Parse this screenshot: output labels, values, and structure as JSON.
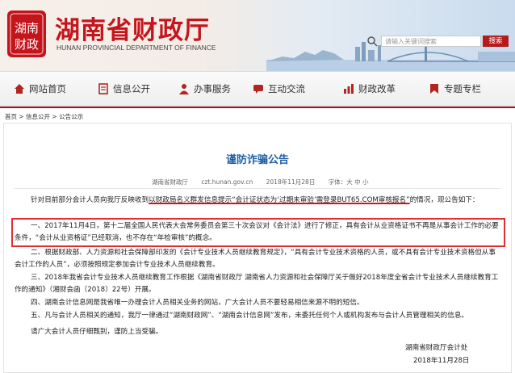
{
  "header": {
    "logo_text": "湖南财政",
    "title": "湖南省财政厅",
    "subtitle": "HUNAN PROVINCIAL DEPARTMENT OF FINANCE",
    "search_placeholder": "请输入关键词搜索",
    "search_button": "搜索"
  },
  "nav": {
    "items": [
      {
        "label": "网站首页",
        "icon": "home-icon"
      },
      {
        "label": "信息公开",
        "icon": "document-icon"
      },
      {
        "label": "办事服务",
        "icon": "service-icon"
      },
      {
        "label": "互动交流",
        "icon": "chat-icon"
      },
      {
        "label": "财政改革",
        "icon": "reform-icon"
      },
      {
        "label": "专题专栏",
        "icon": "topic-icon"
      }
    ]
  },
  "breadcrumb": "首页 > 信息公开 > 公告公示",
  "article": {
    "title": "谨防诈骗公告",
    "source": "湖南省财政厅",
    "url": "czt.hunan.gov.cn",
    "date": "2018年11月28日",
    "font_size": "字体：大 中 小",
    "intro_a": "针对目前部分会计人员向我厅反映收到",
    "intro_b": "以财政局名义群发信息提示“会计证状态为‘过期未审验’需登录BUT65.COM审核报名”",
    "intro_c": "的情况，现公告如下：",
    "p1": "一、2017年11月4日，第十二届全国人民代表大会常务委员会第三十次会议对《会计法》进行了修正，具有会计从业资格证书不再是从事会计工作的必要条件，“会计从业资格证”已经取消，也不存在“年检审核”的概念。",
    "p2": "二、根据财政部、人力资源和社会保障部印发的《会计专业技术人员继续教育规定》，“具有会计专业技术资格的人员，或不具有会计专业技术资格但从事会计工作的人员”，必须按照规定参加会计专业技术人员继续教育。",
    "p3": "三、2018年我省会计专业技术人员继续教育工作根据《湖南省财政厅 湖南省人力资源和社会保障厅关于做好2018年度全省会计专业技术人员继续教育工作的通知》（湘财会函〔2018〕22号）开展。",
    "p4": "四、湖南会计信息网是我省唯一办理会计人员相关业务的网站，广大会计人员不要轻易相信来源不明的短信。",
    "p5": "五、凡与会计人员相关的通知，我厅一律通过“湖南财政网”、“湖南会计信息网”发布，未委托任何个人或机构发布与会计人员管理相关的信息。",
    "closing": "请广大会计人员仔细甄别，谨防上当受骗。",
    "signature": "湖南省财政厅会计处",
    "sign_date": "2018年11月28日"
  },
  "colors": {
    "brand_red": "#c4151c",
    "title_blue": "#1d5fa3",
    "highlight_red": "#e0312f"
  }
}
